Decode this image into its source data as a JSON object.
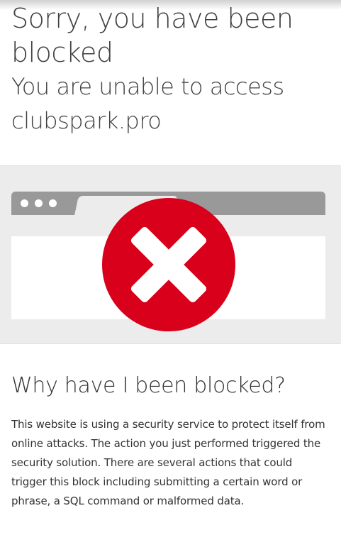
{
  "header": {
    "title": "Sorry, you have been blocked",
    "subtitle_prefix": "You are unable to access",
    "domain": "clubspark.pro"
  },
  "illustration": {
    "icon": "block-x-icon",
    "badge_color": "#d9001b",
    "browser_bar_color": "#999999",
    "band_color": "#ececec"
  },
  "reason": {
    "heading": "Why have I been blocked?",
    "body": "This website is using a security service to protect itself from online attacks. The action you just performed triggered the security solution. There are several actions that could trigger this block including submitting a certain word or phrase, a SQL command or malformed data."
  }
}
